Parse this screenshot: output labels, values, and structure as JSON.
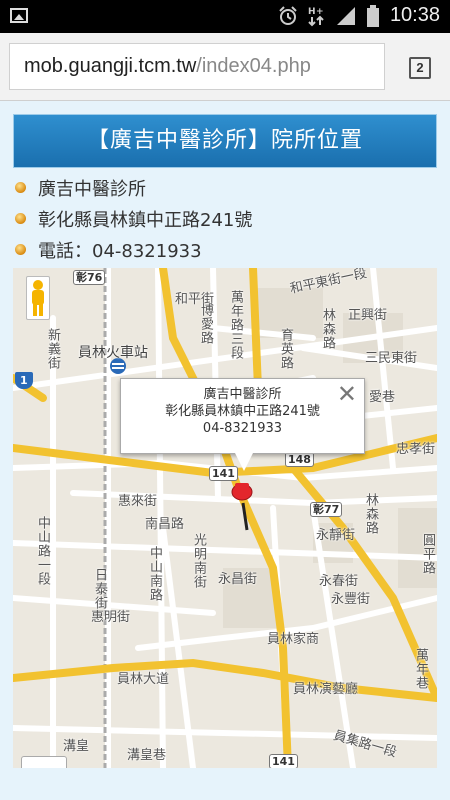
{
  "status_bar": {
    "time": "10:38",
    "icons": [
      "gallery-icon",
      "alarm-icon",
      "network-icon",
      "signal-icon",
      "battery-icon"
    ]
  },
  "browser": {
    "url_host": "mob.guangji.tcm.tw",
    "url_path": "/index04.php",
    "tab_count": "2"
  },
  "page": {
    "title": "【廣吉中醫診所】院所位置",
    "info": [
      "廣吉中醫診所",
      "彰化縣員林鎮中正路241號",
      "電話：04-8321933"
    ]
  },
  "map": {
    "info_window": {
      "name": "廣吉中醫診所",
      "address": "彰化縣員林鎮中正路241號",
      "phone": "04-8321933",
      "close": "✕"
    },
    "labels": {
      "heping": "和平街",
      "boai": "博愛路",
      "wannian3": "萬年路三段",
      "yuying": "育英路",
      "linsen_top": "林森路",
      "zhengxing": "正興街",
      "heping_e": "和平東街一段",
      "sanmin_e": "三民東街",
      "xinyi": "新義街",
      "station": "員林火車站",
      "aixiang": "愛巷",
      "zhongxiao": "忠孝街",
      "huilai": "惠來街",
      "nanchang": "南昌路",
      "guangming": "光明南街",
      "zhongshan_s": "中山南路",
      "zhongshan1": "中山路一段",
      "ritai": "日泰街",
      "yongchang": "永昌街",
      "yongjing": "永靜街",
      "yongchun": "永春街",
      "yongfeng": "永豐街",
      "linsen_r": "林森路",
      "huiming": "惠明街",
      "jiashang": "員林家商",
      "yuanlin_da": "員林大道",
      "yanyi": "員林演藝廳",
      "wannian_lane": "萬年巷",
      "gouhuang": "溝皇",
      "gouhuang_lane": "溝皇巷",
      "yuanji": "員集路一段",
      "yuanping": "圓平路"
    },
    "shields": {
      "r76": "彰76",
      "r1": "1",
      "r141a": "141",
      "r148": "148",
      "r77": "彰77",
      "r141b": "141"
    }
  }
}
